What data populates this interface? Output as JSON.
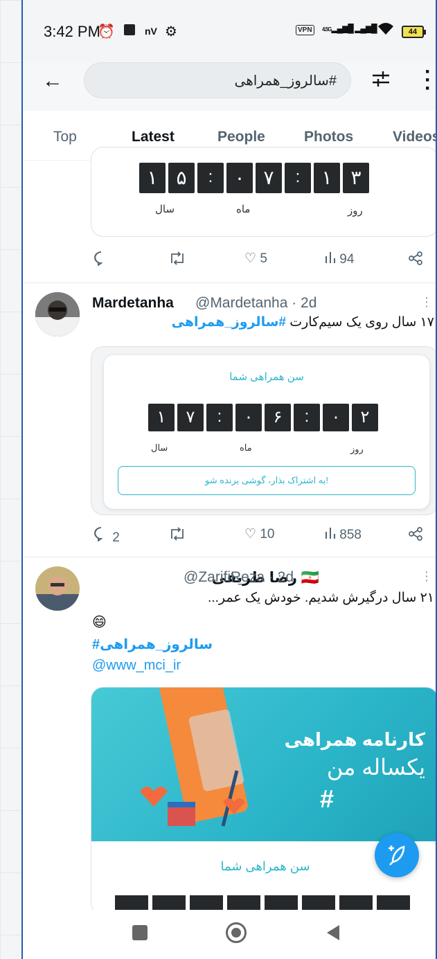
{
  "status": {
    "time": "3:42 PM",
    "icons_left": [
      "alarm-icon",
      "image-icon",
      "nv-icon",
      "settings-icon"
    ],
    "nv": "nV",
    "vpn": "VPN",
    "network": "4.5G",
    "battery": "44"
  },
  "search": {
    "query": "#سالروز_همراهی"
  },
  "tabs": [
    {
      "label": "Top",
      "active": false
    },
    {
      "label": "Latest",
      "active": true
    },
    {
      "label": "People",
      "active": false
    },
    {
      "label": "Photos",
      "active": false
    },
    {
      "label": "Videos",
      "active": false
    }
  ],
  "tweet1": {
    "counter": [
      "۱",
      "۵",
      ":",
      "۰",
      "۷",
      ":",
      "۱",
      "۳"
    ],
    "units": {
      "year": "سال",
      "month": "ماه",
      "day": "روز"
    },
    "actions": {
      "replies": "",
      "retweets": "",
      "likes": "5",
      "views": "94"
    }
  },
  "tweet2": {
    "name": "Mardetanha",
    "handle": "@Mardetanha · 2d",
    "text": "۱۷ سال روی یک سیم‌کارت",
    "hashtag": "#سالروز_همراهی",
    "card_title": "سن همراهی شما",
    "counter": [
      "۱",
      "۷",
      ":",
      "۰",
      "۶",
      ":",
      "۰",
      "۲"
    ],
    "units": {
      "year": "سال",
      "month": "ماه",
      "day": "روز"
    },
    "share_button": "به اشتراک بذار، گوشی برنده شو!",
    "actions": {
      "replies": "2",
      "retweets": "",
      "likes": "10",
      "views": "858"
    }
  },
  "tweet3": {
    "name": "رضا ظریفی",
    "flag": "🇮🇷",
    "handle": "@ZarifiReza · 2d",
    "text": "۲۱ سال درگیرش شدیم. خودش یک عمر...",
    "emoji": "😄",
    "hashtag": "سالروز_همراهی#",
    "mention": "@www_mci_ir",
    "banner_title": "کارنامه همراهی",
    "banner_sub": "یکساله من",
    "card_title": "سن همراهی شما"
  },
  "colors": {
    "accent": "#1d9bf0",
    "teal": "#2bb5c9",
    "orange": "#f58a3c"
  }
}
